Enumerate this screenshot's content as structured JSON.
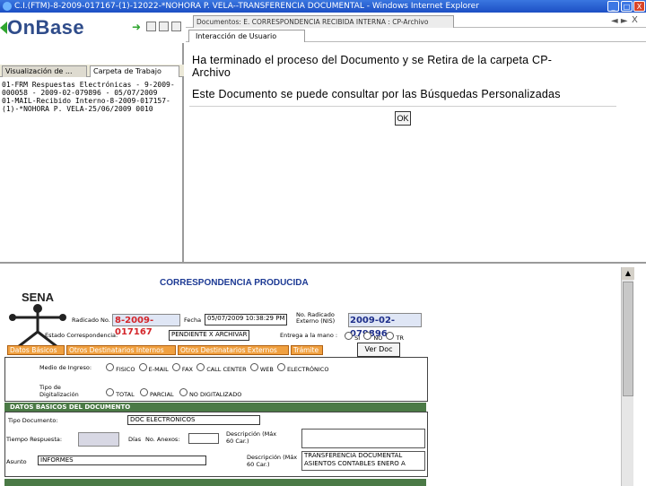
{
  "window": {
    "title": "C.I.(FTM)-8-2009-017167-(1)-12022-*NOHORA P. VELA--TRANSFERENCIA DOCUMENTAL - Windows Internet Explorer",
    "min_label": "_",
    "max_label": "□",
    "close_label": "X"
  },
  "left": {
    "logo": "OnBase",
    "tabs": [
      "Visualización de ...",
      "Carpeta de Trabajo"
    ],
    "items": [
      "01-FRM Respuestas Electrónicas - 9-2009-",
      "000058 - 2009-02-079896 - 05/07/2009",
      "01-MAIL-Recibido Interno-8-2009-017157-",
      "(1)-*NOHORA P. VELA-25/06/2009 0010"
    ]
  },
  "doc": {
    "tab_label": "Documentos: E. CORRESPONDENCIA RECIBIDA INTERNA : CP-Archivo",
    "nav_label": "◄ ►",
    "close_label": "X",
    "subtab": "Interacción de Usuario",
    "message_line1": "Ha terminado el proceso del Documento y se Retira de la carpeta CP-",
    "message_line2": "Archivo",
    "message_line3": "Este Documento se puede consultar por las Búsquedas Personalizadas",
    "ok_label": "OK"
  },
  "form": {
    "title": "CORRESPONDENCIA PRODUCIDA",
    "logo_text": "SENA",
    "radicado_label": "Radicado No.",
    "radicado_value": "8-2009-017167",
    "fecha_label": "Fecha",
    "fecha_value": "05/07/2009 10:38:29 PM",
    "radicado_externo_label": "No. Radicado Externo (NIS)",
    "radicado_externo_value": "2009-02-079896",
    "estado_label": "Estado Correspondencia:",
    "estado_value": "PENDIENTE X ARCHIVAR",
    "entrega_label": "Entrega a la mano :",
    "entrega_options": [
      "SI",
      "NO",
      "TR"
    ],
    "tabs": [
      "Datos Básicos",
      "Otros Destinatarios Internos",
      "Otros Destinatarios Externos",
      "Trámite"
    ],
    "ver_doc": "Ver Doc",
    "medio_label": "Medio de Ingreso:",
    "medio_options": [
      "FISICO",
      "E-MAIL",
      "FAX",
      "CALL CENTER",
      "WEB",
      "ELECTRÓNICO"
    ],
    "digitalizacion_label": "Tipo de Digitalización",
    "digitalizacion_options": [
      "TOTAL",
      "PARCIAL",
      "NO DIGITALIZADO"
    ],
    "datos_basicos_header": "DATOS BASICOS DEL DOCUMENTO",
    "tipo_doc_label": "Tipo Documento:",
    "tipo_doc_value": "DOC ELECTRONICOS",
    "tiempo_label": "Tiempo Respuesta:",
    "dias_label": "Días",
    "anexos_label": "No. Anexos:",
    "desc1_label": "Descripción (Máx 60 Car.)",
    "asunto_label": "Asunto",
    "asunto_value": "INFORMES",
    "desc2_label": "Descripción (Máx 60 Car.)",
    "desc2_value_line1": "TRANSFERENCIA DOCUMENTAL",
    "desc2_value_line2": "ASIENTOS CONTABLES ENERO A"
  }
}
